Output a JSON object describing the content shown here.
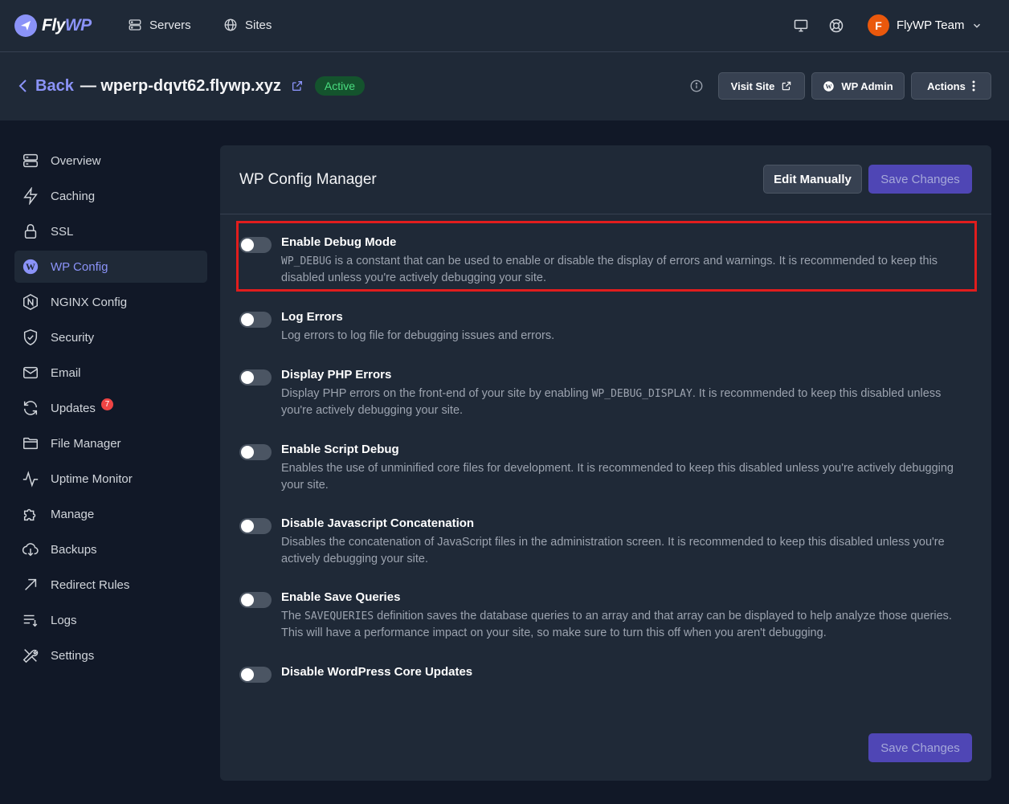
{
  "brand": {
    "name_part1": "Fly",
    "name_part2": "WP"
  },
  "nav": {
    "servers": "Servers",
    "sites": "Sites"
  },
  "user": {
    "initial": "F",
    "team": "FlyWP Team"
  },
  "header": {
    "back": "Back",
    "site": "— wperp-dqvt62.flywp.xyz",
    "status": "Active",
    "visit_site": "Visit Site",
    "wp_admin": "WP Admin",
    "actions": "Actions"
  },
  "sidebar": {
    "items": [
      {
        "label": "Overview",
        "icon": "server-icon"
      },
      {
        "label": "Caching",
        "icon": "bolt-icon"
      },
      {
        "label": "SSL",
        "icon": "lock-icon"
      },
      {
        "label": "WP Config",
        "icon": "wordpress-icon"
      },
      {
        "label": "NGINX Config",
        "icon": "nginx-icon"
      },
      {
        "label": "Security",
        "icon": "shield-icon"
      },
      {
        "label": "Email",
        "icon": "envelope-icon"
      },
      {
        "label": "Updates",
        "icon": "refresh-icon",
        "badge": "7"
      },
      {
        "label": "File Manager",
        "icon": "folder-icon"
      },
      {
        "label": "Uptime Monitor",
        "icon": "pulse-icon"
      },
      {
        "label": "Manage",
        "icon": "puzzle-icon"
      },
      {
        "label": "Backups",
        "icon": "cloud-download-icon"
      },
      {
        "label": "Redirect Rules",
        "icon": "arrow-up-right-icon"
      },
      {
        "label": "Logs",
        "icon": "list-icon"
      },
      {
        "label": "Settings",
        "icon": "tools-icon"
      }
    ]
  },
  "panel": {
    "title": "WP Config Manager",
    "edit_manually": "Edit Manually",
    "save_changes": "Save Changes"
  },
  "options": [
    {
      "title": "Enable Debug Mode",
      "enabled": false,
      "code": "WP_DEBUG",
      "desc_pre": "",
      "desc_post": " is a constant that can be used to enable or disable the display of errors and warnings. It is recommended to keep this disabled unless you're actively debugging your site."
    },
    {
      "title": "Log Errors",
      "enabled": false,
      "desc": "Log errors to log file for debugging issues and errors."
    },
    {
      "title": "Display PHP Errors",
      "enabled": false,
      "desc_pre": "Display PHP errors on the front-end of your site by enabling ",
      "code": "WP_DEBUG_DISPLAY",
      "desc_post": ". It is recommended to keep this disabled unless you're actively debugging your site."
    },
    {
      "title": "Enable Script Debug",
      "enabled": false,
      "desc": "Enables the use of unminified core files for development. It is recommended to keep this disabled unless you're actively debugging your site."
    },
    {
      "title": "Disable Javascript Concatenation",
      "enabled": false,
      "desc": "Disables the concatenation of JavaScript files in the administration screen. It is recommended to keep this disabled unless you're actively debugging your site."
    },
    {
      "title": "Enable Save Queries",
      "enabled": false,
      "desc_pre": "The ",
      "code": "SAVEQUERIES",
      "desc_post": " definition saves the database queries to an array and that array can be displayed to help analyze those queries. This will have a performance impact on your site, so make sure to turn this off when you aren't debugging."
    },
    {
      "title": "Disable WordPress Core Updates",
      "enabled": false,
      "desc": ""
    }
  ],
  "colors": {
    "accent": "#8b93f8",
    "background": "#111827",
    "panel": "#1f2937",
    "highlight": "#e11d1d",
    "success": "#4ade80"
  }
}
